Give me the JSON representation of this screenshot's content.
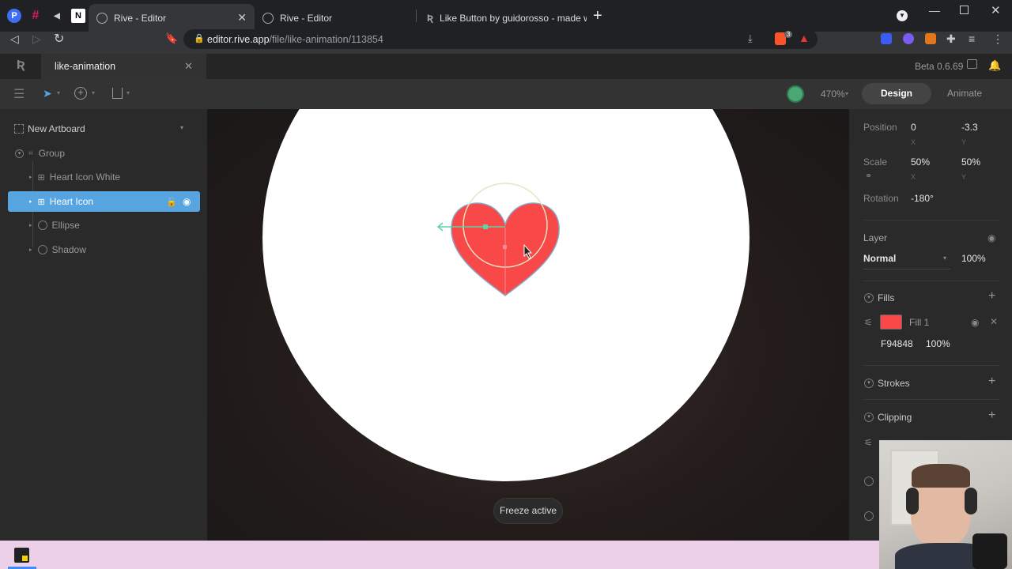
{
  "browser": {
    "tabs": [
      {
        "title": "Rive - Editor",
        "active": true
      },
      {
        "title": "Rive - Editor",
        "active": false
      },
      {
        "title": "Like Button by guidorosso - made wit",
        "active": false
      }
    ],
    "url_host": "editor.rive.app",
    "url_path": "/file/like-animation/113854",
    "ext_badge": "3"
  },
  "app": {
    "file_tab": "like-animation",
    "version": "Beta 0.6.69",
    "zoom": "470%",
    "mode_tabs": [
      "Design",
      "Animate"
    ],
    "active_mode": "Design"
  },
  "layers": {
    "artboard": "New Artboard",
    "items": [
      {
        "label": "Group"
      },
      {
        "label": "Heart Icon White"
      },
      {
        "label": "Heart Icon",
        "selected": true
      },
      {
        "label": "Ellipse"
      },
      {
        "label": "Shadow"
      }
    ]
  },
  "canvas": {
    "freeze_label": "Freeze active",
    "heart_color": "#F94848"
  },
  "props": {
    "position_label": "Position",
    "pos_x": "0",
    "pos_y": "-3.3",
    "x": "X",
    "y": "Y",
    "scale_label": "Scale",
    "scale_x": "50%",
    "scale_y": "50%",
    "rotation_label": "Rotation",
    "rotation": "-180°",
    "layer_label": "Layer",
    "blend": "Normal",
    "opacity": "100%",
    "fills_label": "Fills",
    "fill_name": "Fill 1",
    "fill_hex": "F94848",
    "fill_opacity": "100%",
    "fill_color": "#F94848",
    "strokes_label": "Strokes",
    "clipping_label": "Clipping"
  }
}
